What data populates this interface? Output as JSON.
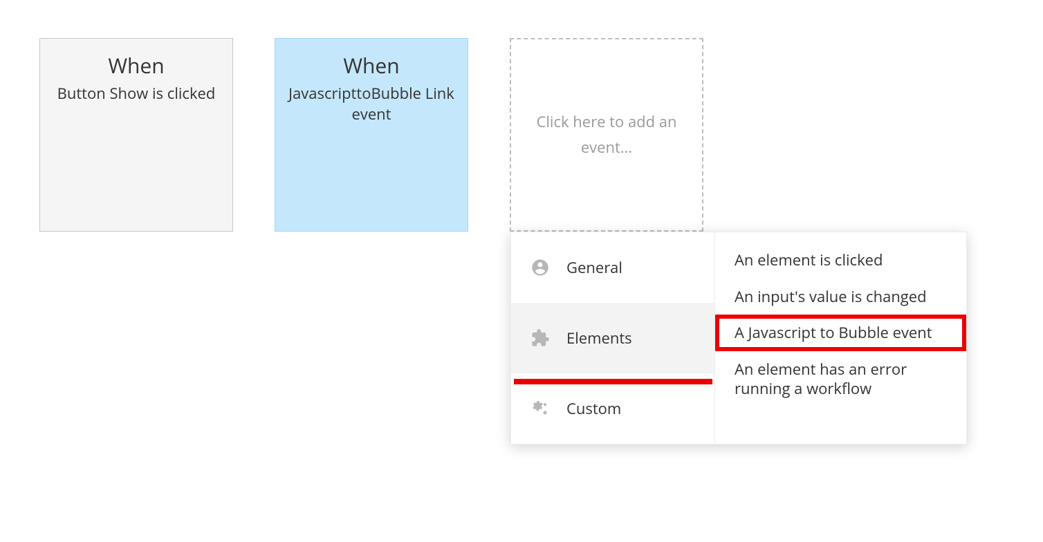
{
  "events": [
    {
      "when": "When",
      "desc": "Button Show is clicked",
      "selected": false
    },
    {
      "when": "When",
      "desc": "JavascripttoBubble Link event",
      "selected": true
    }
  ],
  "add_event_placeholder": "Click here to add an event...",
  "menu": {
    "categories": [
      {
        "label": "General",
        "icon": "user-circle",
        "active": false
      },
      {
        "label": "Elements",
        "icon": "plugin",
        "active": true
      },
      {
        "label": "Custom",
        "icon": "gears",
        "active": false
      }
    ],
    "items": [
      {
        "label": "An element is clicked",
        "highlighted": false
      },
      {
        "label": "An input's value is changed",
        "highlighted": false
      },
      {
        "label": "A Javascript to Bubble event",
        "highlighted": true
      },
      {
        "label": "An element has an error running a workflow",
        "highlighted": false
      }
    ]
  }
}
